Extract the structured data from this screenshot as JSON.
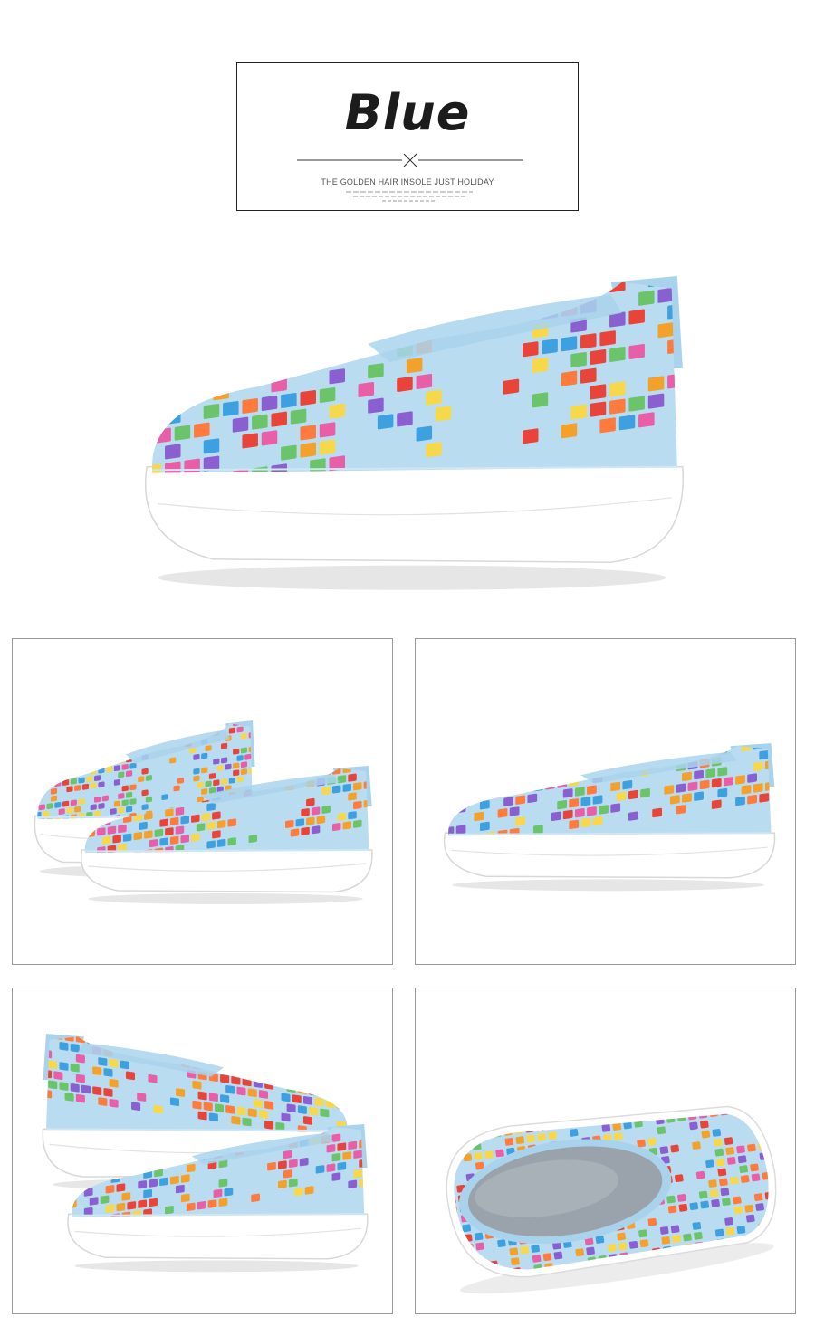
{
  "header": {
    "title": "Blue",
    "tagline": "THE GOLDEN HAIR INSOLE JUST HOLIDAY"
  },
  "product": {
    "color_name": "Blue",
    "colors": {
      "upper_base": "#b9dcf0",
      "sole": "#ffffff",
      "heel_tab": "#a9d3ec",
      "insole": "#9aa3ab"
    },
    "weave_palette": [
      "#e8443a",
      "#f4a12c",
      "#f7d84b",
      "#6cc46a",
      "#3fa0e0",
      "#8a5fd0",
      "#e85fa8",
      "#ff7a3d",
      "#b9dcf0"
    ]
  },
  "gallery": {
    "views": [
      {
        "name": "pair-front-angle"
      },
      {
        "name": "side-profile"
      },
      {
        "name": "pair-side-angle"
      },
      {
        "name": "top-interior"
      }
    ]
  }
}
